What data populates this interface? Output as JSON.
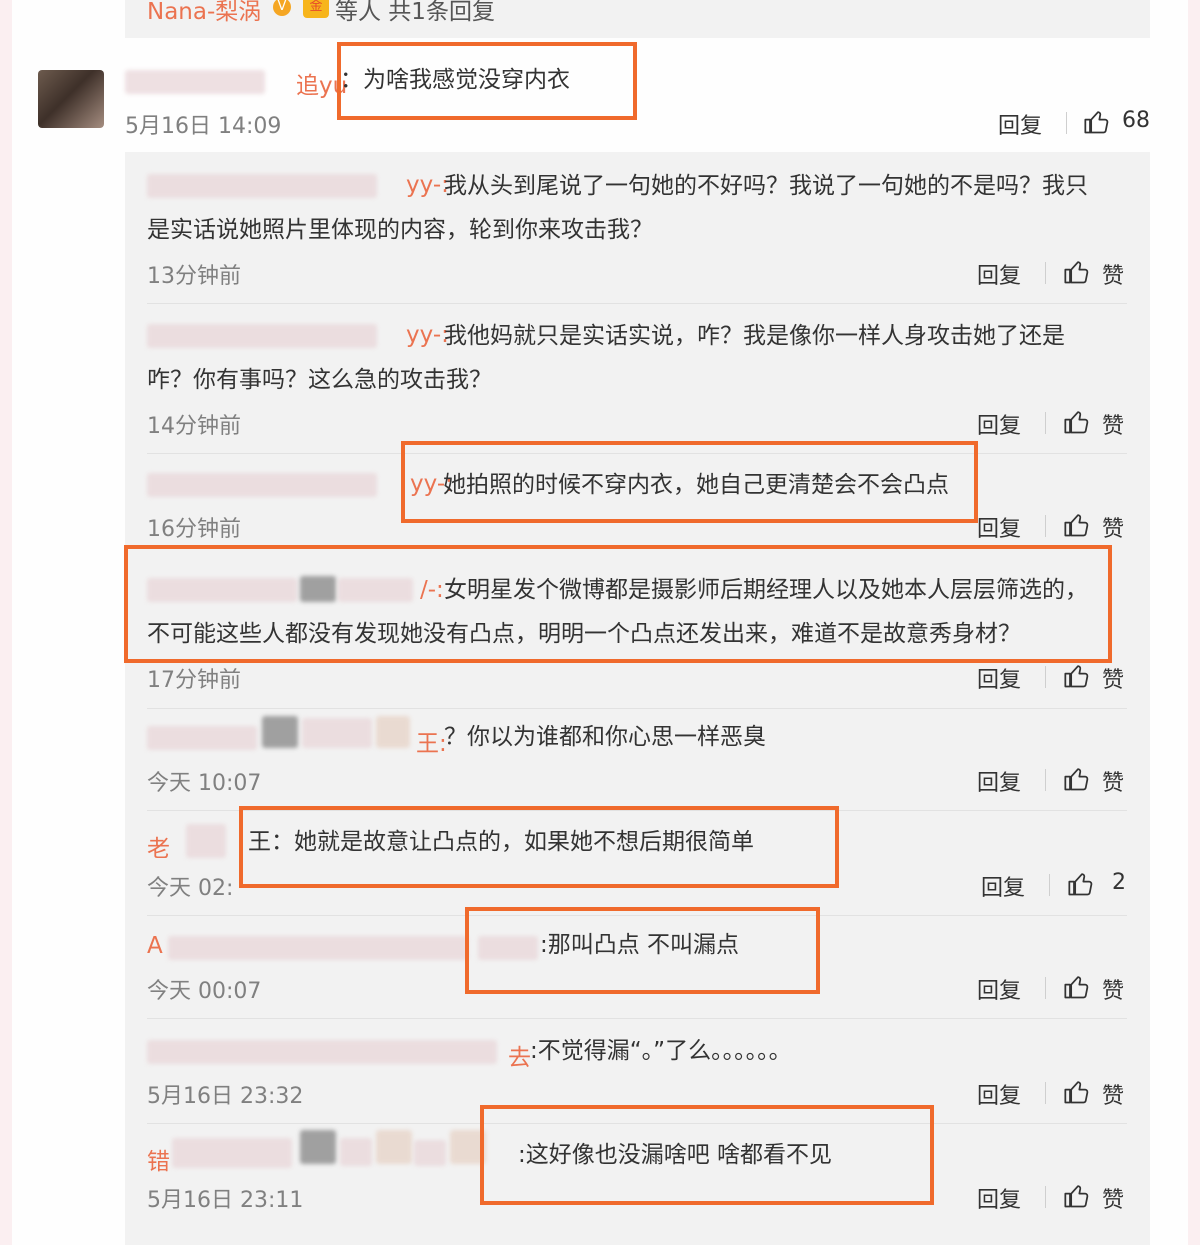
{
  "top_banner": {
    "author": "Nana-梨涡",
    "summary": "等人 共1条回复"
  },
  "main_comment": {
    "name_visible": "追yu",
    "text": "：为啥我感觉没穿内衣",
    "time": "5月16日 14:09",
    "reply_label": "回复",
    "likes": "68"
  },
  "replies": [
    {
      "name_visible": "yy-:",
      "line1": "我从头到尾说了一句她的不好吗？我说了一句她的不是吗？我只",
      "line2": "是实话说她照片里体现的内容，轮到你来攻击我？",
      "time": "13分钟前",
      "reply_label": "回复",
      "like_label": "赞"
    },
    {
      "name_visible": "yy-:",
      "line1": "我他妈就只是实话实说，咋？我是像你一样人身攻击她了还是",
      "line2": "咋？你有事吗？这么急的攻击我？",
      "time": "14分钟前",
      "reply_label": "回复",
      "like_label": "赞"
    },
    {
      "name_visible": "yy-:",
      "line1": "她拍照的时候不穿内衣，她自己更清楚会不会凸点",
      "line2": "",
      "time": "16分钟前",
      "reply_label": "回复",
      "like_label": "赞"
    },
    {
      "name_visible": "/-:",
      "line1": "女明星发个微博都是摄影师后期经理人以及她本人层层筛选的，",
      "line2": "不可能这些人都没有发现她没有凸点，明明一个凸点还发出来，难道不是故意秀身材？",
      "time": "17分钟前",
      "reply_label": "回复",
      "like_label": "赞"
    },
    {
      "name_visible": "王:",
      "line1": "？你以为谁都和你心思一样恶臭",
      "line2": "",
      "time": "今天 10:07",
      "reply_label": "回复",
      "like_label": "赞"
    },
    {
      "name_visible": "老",
      "line1": "王：她就是故意让凸点的，如果她不想后期很简单",
      "line2": "",
      "time": "今天 02:",
      "reply_label": "回复",
      "like_label": "2"
    },
    {
      "name_visible": "A",
      "line1": ":那叫凸点 不叫漏点",
      "line2": "",
      "time": "今天 00:07",
      "reply_label": "回复",
      "like_label": "赞"
    },
    {
      "name_visible": "去",
      "line1": ":不觉得漏“。”了么。。。。。。",
      "line2": "",
      "time": "5月16日 23:32",
      "reply_label": "回复",
      "like_label": "赞"
    },
    {
      "name_visible": "错",
      "line1": ":这好像也没漏啥吧 啥都看不见",
      "line2": "",
      "time": "5月16日 23:11",
      "reply_label": "回复",
      "like_label": "赞"
    }
  ],
  "colors": {
    "highlight": "#f06a2c",
    "username": "#eb7350",
    "panel": "#f2f2f2",
    "outer": "#fbeff1"
  },
  "icons": [
    "thumbs-up-icon",
    "verified-icon",
    "vip-badge-icon"
  ]
}
